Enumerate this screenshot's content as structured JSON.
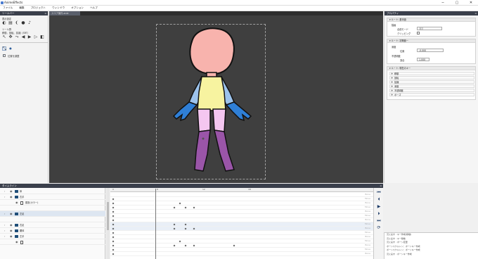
{
  "window": {
    "title": "AnimeEffects",
    "buttons": [
      "─",
      "▢",
      "✕"
    ]
  },
  "menu": [
    "ファイル",
    "編集",
    "プロジェクト",
    "ウィンドウ",
    "オプション",
    "ヘルプ"
  ],
  "tool_panel": {
    "title": "ツールバー",
    "display_label": "表示設定",
    "display_icons": [
      "◐",
      "▤",
      "❨",
      "●",
      "♪"
    ],
    "tools_label": "ツール群",
    "tools_sub": "移動、回転、拡縮（SRT）",
    "tool_icons": [
      "↖",
      "✥",
      "⤳",
      "◀",
      "▶",
      "▷",
      "◧"
    ],
    "sel_icons": [
      "⤡",
      "●"
    ],
    "checkbox_label": "位置を調整",
    "checkbox_checked": true
  },
  "canvas": {
    "tab_label": "スコア案件.anie"
  },
  "props": {
    "title": "プロパティ",
    "sec1": {
      "title": "ルート: 基本値",
      "subtitle": "描画",
      "blend_label": "合成モード",
      "blend_value": "通常",
      "clip_label": "クリッピング"
    },
    "sec2": {
      "title": "ルート: 初期値ー",
      "depth_label": "深度",
      "pos_label": "位置",
      "pos_value": "-0.000",
      "opacity_label": "不透明度",
      "rate_label": "割合",
      "rate_value": "1.000"
    },
    "sec3": {
      "title": "ルート: 現在のキー",
      "rows": [
        "移動",
        "回転",
        "拡縮",
        "深度",
        "不透明度",
        "ポーズ"
      ]
    }
  },
  "timeline": {
    "title": "タイムライン",
    "ruler": [
      "0",
      "6",
      "12",
      "18"
    ],
    "layers": [
      {
        "name": "体",
        "type": "folder",
        "indent": 1
      },
      {
        "name": "右手",
        "type": "folder",
        "indent": 1
      },
      {
        "name": "肌影(カラー)",
        "type": "doc",
        "indent": 2
      },
      {
        "name": "",
        "type": "blank",
        "indent": 2
      },
      {
        "name": "左足",
        "type": "folder",
        "indent": 1
      },
      {
        "name": "",
        "type": "blank",
        "indent": 2
      },
      {
        "name": "右足",
        "type": "folder",
        "indent": 1
      },
      {
        "name": "胴体",
        "type": "folder",
        "indent": 1
      },
      {
        "name": "左手",
        "type": "folder",
        "indent": 1
      },
      {
        "name": "",
        "type": "doc",
        "indent": 2
      }
    ],
    "key_tags": [
      "Bone",
      "Move",
      "Bone",
      "Move",
      "Bone",
      "Move",
      "Bone",
      "Move",
      "Bone",
      "Move",
      "Bone",
      "Move",
      "Bone",
      "Move",
      "Bone"
    ],
    "transport": [
      "⏮",
      "⏴",
      "▶",
      "⏵",
      "⏭",
      "⟳"
    ]
  },
  "log": [
    "元に戻す : キー作成(移動)",
    "元に戻す : キー移動",
    "元に戻す : ボーン変更",
    "ボーンスケルトン：ボーンキー作成",
    "ボーンスケルトン：ボーンキー作成",
    "元に戻す : ボーンキー作成"
  ],
  "colors": {
    "panel_head": "#3a3f4b",
    "canvas_bg": "#3f3f3f",
    "skin": "#f8b3ad",
    "shirt": "#f7f3a0",
    "arm_upper": "#9cc3ec",
    "arm_lower": "#2f7fd6",
    "leg_upper": "#f4c6f0",
    "leg_lower": "#9a55a8"
  }
}
